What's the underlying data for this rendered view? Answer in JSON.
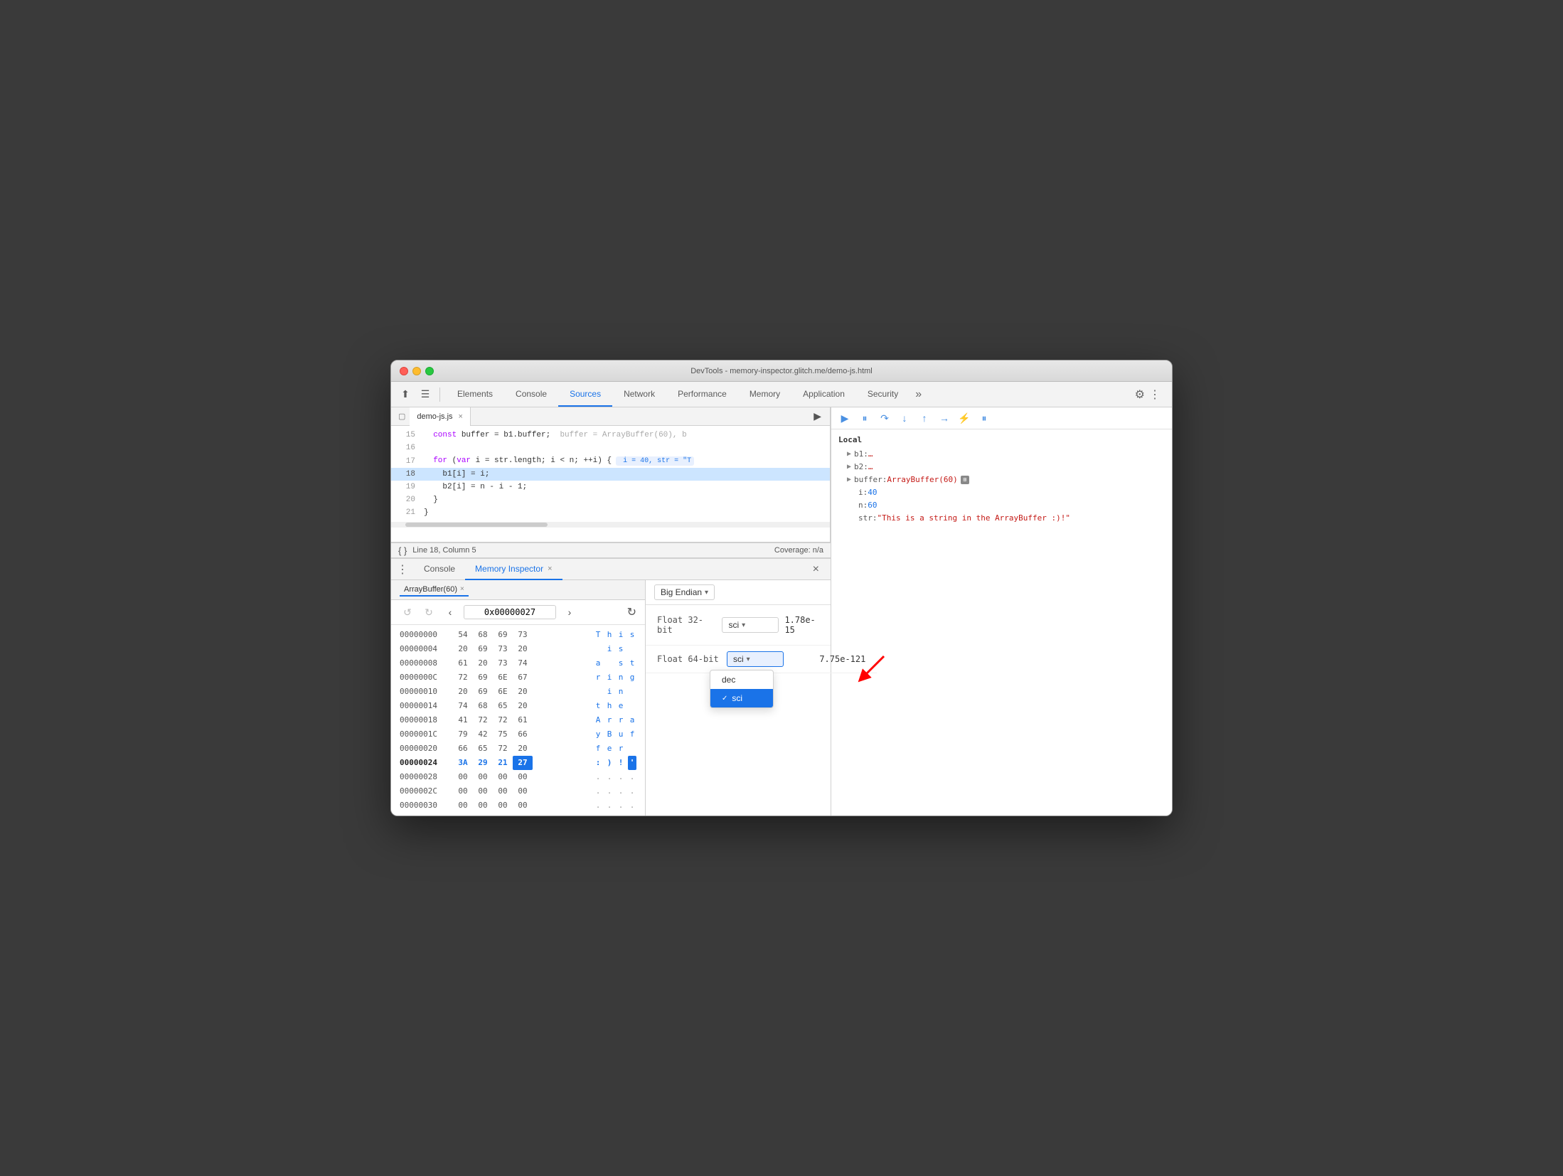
{
  "window": {
    "title": "DevTools - memory-inspector.glitch.me/demo-js.html"
  },
  "tabs": {
    "items": [
      "Elements",
      "Console",
      "Sources",
      "Network",
      "Performance",
      "Memory",
      "Application",
      "Security"
    ],
    "active": "Sources",
    "more_label": "»",
    "gear_label": "⚙",
    "dots_label": "⋮"
  },
  "toolbar": {
    "cursor_icon": "⬆",
    "layers_icon": "☰",
    "inspect_icon": "▢"
  },
  "source_editor": {
    "tab_name": "demo-js.js",
    "close_x": "×",
    "lines": [
      {
        "num": "15",
        "content": "  const buffer = b1.buffer;  buffer = ArrayBuffer(60), b"
      },
      {
        "num": "16",
        "content": ""
      },
      {
        "num": "17",
        "content": "  for (var i = str.length; i < n; ++i) {  i = 40, str = \"T"
      },
      {
        "num": "18",
        "content": "    b1[i] = i;",
        "highlighted": true
      },
      {
        "num": "19",
        "content": "    b2[i] = n - i - 1;"
      },
      {
        "num": "20",
        "content": "  }"
      },
      {
        "num": "21",
        "content": "}"
      }
    ],
    "status": "Line 18, Column 5",
    "coverage": "Coverage: n/a"
  },
  "debug_panel": {
    "variables": {
      "section": "Local",
      "items": [
        {
          "key": "b1:",
          "val": "…",
          "has_arrow": true
        },
        {
          "key": "b2:",
          "val": "…",
          "has_arrow": true
        },
        {
          "key": "buffer:",
          "val": "ArrayBuffer(60)",
          "has_mem_icon": true,
          "has_arrow": true
        },
        {
          "key": "i:",
          "val": "40"
        },
        {
          "key": "n:",
          "val": "60"
        },
        {
          "key": "str:",
          "val": "\"This is a string in the ArrayBuffer :)!\""
        }
      ]
    }
  },
  "bottom_panel": {
    "tabs": [
      "Console",
      "Memory Inspector"
    ],
    "active": "Memory Inspector",
    "close_label": "×",
    "close_panel_label": "×"
  },
  "memory_buffer_tab": {
    "label": "ArrayBuffer(60)",
    "close": "×"
  },
  "memory_nav": {
    "back_label": "↺",
    "forward_label": "↻",
    "prev_label": "‹",
    "next_label": "›",
    "address": "0x00000027",
    "refresh_label": "↻"
  },
  "hex_rows": [
    {
      "addr": "00000000",
      "bytes": [
        "54",
        "68",
        "69",
        "73"
      ],
      "chars": [
        "T",
        "h",
        "i",
        "s"
      ],
      "chars_dim": [
        false,
        false,
        false,
        false
      ]
    },
    {
      "addr": "00000004",
      "bytes": [
        "20",
        "69",
        "73",
        "20"
      ],
      "chars": [
        " ",
        "i",
        "s",
        " "
      ],
      "chars_dim": [
        true,
        false,
        false,
        true
      ]
    },
    {
      "addr": "00000008",
      "bytes": [
        "61",
        "20",
        "73",
        "74"
      ],
      "chars": [
        "a",
        " ",
        "s",
        "t"
      ],
      "chars_dim": [
        false,
        true,
        false,
        false
      ]
    },
    {
      "addr": "0000000C",
      "bytes": [
        "72",
        "69",
        "6E",
        "67"
      ],
      "chars": [
        "r",
        "i",
        "n",
        "g"
      ],
      "chars_dim": [
        false,
        false,
        false,
        false
      ]
    },
    {
      "addr": "00000010",
      "bytes": [
        "20",
        "69",
        "6E",
        "20"
      ],
      "chars": [
        " ",
        "i",
        "n",
        " "
      ],
      "chars_dim": [
        true,
        false,
        false,
        true
      ]
    },
    {
      "addr": "00000014",
      "bytes": [
        "74",
        "68",
        "65",
        "20"
      ],
      "chars": [
        "t",
        "h",
        "e",
        " "
      ],
      "chars_dim": [
        false,
        false,
        false,
        true
      ]
    },
    {
      "addr": "00000018",
      "bytes": [
        "41",
        "72",
        "72",
        "61"
      ],
      "chars": [
        "A",
        "r",
        "r",
        "a"
      ],
      "chars_dim": [
        false,
        false,
        false,
        false
      ]
    },
    {
      "addr": "0000001C",
      "bytes": [
        "79",
        "42",
        "75",
        "66"
      ],
      "chars": [
        "y",
        "B",
        "u",
        "f"
      ],
      "chars_dim": [
        false,
        false,
        false,
        false
      ]
    },
    {
      "addr": "00000020",
      "bytes": [
        "66",
        "65",
        "72",
        "20"
      ],
      "chars": [
        "f",
        "e",
        "r",
        " "
      ],
      "chars_dim": [
        false,
        false,
        false,
        true
      ]
    },
    {
      "addr": "00000024",
      "bytes": [
        "3A",
        "29",
        "21",
        "27"
      ],
      "chars": [
        ":",
        ")",
        " ",
        "'"
      ],
      "chars_dim": [
        false,
        false,
        false,
        false
      ],
      "is_current": true,
      "selected_byte_idx": 3,
      "selected_char_idx": 3
    },
    {
      "addr": "00000028",
      "bytes": [
        "00",
        "00",
        "00",
        "00"
      ],
      "chars": [
        ".",
        ".",
        ".",
        "."
      ],
      "chars_dim": [
        true,
        true,
        true,
        true
      ]
    },
    {
      "addr": "0000002C",
      "bytes": [
        "00",
        "00",
        "00",
        "00"
      ],
      "chars": [
        ".",
        ".",
        ".",
        "."
      ],
      "chars_dim": [
        true,
        true,
        true,
        true
      ]
    },
    {
      "addr": "00000030",
      "bytes": [
        "00",
        "00",
        "00",
        "00"
      ],
      "chars": [
        ".",
        ".",
        ".",
        "."
      ],
      "chars_dim": [
        true,
        true,
        true,
        true
      ]
    }
  ],
  "memory_right": {
    "endian_label": "Big Endian",
    "endian_arrow": "▾",
    "settings_icon": "⚙",
    "types": [
      {
        "label": "Float 32-bit",
        "format": "sci",
        "format_arrow": "▾",
        "value": "1.78e-15"
      },
      {
        "label": "Float 64-bit",
        "format": "sci",
        "format_arrow": "▾",
        "value": "7.75e-121"
      }
    ],
    "dropdown": {
      "visible": true,
      "options": [
        "dec",
        "sci"
      ],
      "selected": "sci"
    }
  }
}
